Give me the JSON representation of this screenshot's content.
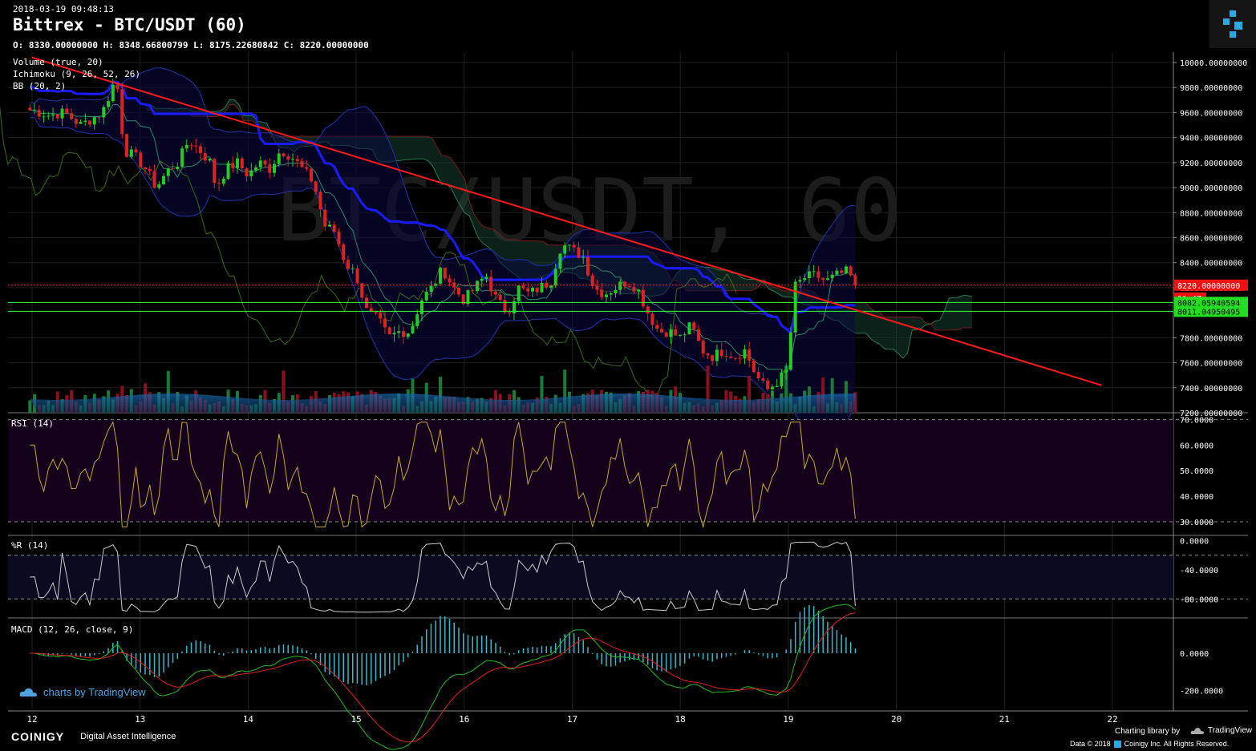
{
  "header": {
    "timestamp": "2018-03-19 09:48:13",
    "title": "Bittrex - BTC/USDT (60)",
    "ohlc": "O: 8330.00000000 H: 8348.66800799 L: 8175.22680842 C: 8220.00000000"
  },
  "watermark": "BTC/USDT, 60",
  "indicators": {
    "volume": "Volume (true, 20)",
    "ichimoku": "Ichimoku (9, 26, 52, 26)",
    "bb": "BB (20, 2)",
    "rsi": "RSI (14)",
    "willr": "%R (14)",
    "macd": "MACD (12, 26, close, 9)"
  },
  "price_badges": {
    "last_price": "8220.00000000",
    "countdown": "11:47",
    "level_1": "8082.05940594",
    "level_2": "8011.04950495"
  },
  "colors": {
    "up": "#22cc22",
    "down": "#dd2222",
    "trendline": "#ff1a1a",
    "bb_mid": "#1a1aff",
    "level": "#33ff33",
    "rsi": "#c8a830",
    "willr": "#cccccc",
    "macd": "#22bb22",
    "signal": "#dd2222",
    "hist": "#33bbcc"
  },
  "branding": {
    "tv_chart": "charts by TradingView",
    "coinigy": "COINIGY",
    "tagline": "Digital Asset Intelligence",
    "charting_by": "Charting library by",
    "tradingview": "TradingView",
    "copyright": "Data © 2018",
    "coinigy_rights": "Coinigy Inc. All Rights Reserved."
  },
  "chart_data": [
    {
      "type": "candlestick",
      "title": "Bittrex - BTC/USDT (60)",
      "x_ticks": [
        "12",
        "13",
        "14",
        "15",
        "16",
        "17",
        "18",
        "19",
        "20",
        "21",
        "22"
      ],
      "y_ticks": [
        "10000.00000000",
        "9800.00000000",
        "9600.00000000",
        "9400.00000000",
        "9200.00000000",
        "9000.00000000",
        "8800.00000000",
        "8600.00000000",
        "8400.00000000",
        "8200.00000000",
        "8000.00000000",
        "7800.00000000",
        "7600.00000000",
        "7400.00000000",
        "7200.00000000"
      ],
      "ylim": [
        7200,
        10100
      ],
      "last": 8220,
      "trendline": {
        "from": [
          11.8,
          10040
        ],
        "to": [
          21.7,
          7420
        ]
      },
      "close_path": [
        [
          11.8,
          9620
        ],
        [
          11.95,
          9580
        ],
        [
          12.1,
          9600
        ],
        [
          12.25,
          9500
        ],
        [
          12.35,
          9550
        ],
        [
          12.45,
          9600
        ],
        [
          12.55,
          9820
        ],
        [
          12.6,
          9780
        ],
        [
          12.65,
          9300
        ],
        [
          12.75,
          9250
        ],
        [
          12.85,
          9150
        ],
        [
          12.95,
          9000
        ],
        [
          13.05,
          9130
        ],
        [
          13.15,
          9200
        ],
        [
          13.25,
          9380
        ],
        [
          13.35,
          9300
        ],
        [
          13.45,
          9200
        ],
        [
          13.5,
          9000
        ],
        [
          13.6,
          9150
        ],
        [
          13.7,
          9200
        ],
        [
          13.8,
          9100
        ],
        [
          13.9,
          9200
        ],
        [
          14.0,
          9150
        ],
        [
          14.1,
          9300
        ],
        [
          14.2,
          9250
        ],
        [
          14.3,
          9150
        ],
        [
          14.4,
          9050
        ],
        [
          14.45,
          8900
        ],
        [
          14.5,
          8700
        ],
        [
          14.6,
          8650
        ],
        [
          14.7,
          8400
        ],
        [
          14.8,
          8300
        ],
        [
          14.9,
          8000
        ],
        [
          15.0,
          7950
        ],
        [
          15.1,
          7800
        ],
        [
          15.2,
          7850
        ],
        [
          15.3,
          7850
        ],
        [
          15.4,
          8100
        ],
        [
          15.5,
          8200
        ],
        [
          15.6,
          8350
        ],
        [
          15.7,
          8200
        ],
        [
          15.8,
          8100
        ],
        [
          15.9,
          8200
        ],
        [
          16.0,
          8300
        ],
        [
          16.1,
          8100
        ],
        [
          16.2,
          8000
        ],
        [
          16.3,
          8200
        ],
        [
          16.4,
          8150
        ],
        [
          16.5,
          8200
        ],
        [
          16.6,
          8250
        ],
        [
          16.7,
          8550
        ],
        [
          16.8,
          8500
        ],
        [
          16.9,
          8450
        ],
        [
          17.0,
          8200
        ],
        [
          17.1,
          8150
        ],
        [
          17.2,
          8200
        ],
        [
          17.3,
          8250
        ],
        [
          17.4,
          8200
        ],
        [
          17.5,
          8000
        ],
        [
          17.6,
          7850
        ],
        [
          17.7,
          7850
        ],
        [
          17.8,
          7800
        ],
        [
          17.9,
          7900
        ],
        [
          18.0,
          7700
        ],
        [
          18.1,
          7650
        ],
        [
          18.2,
          7700
        ],
        [
          18.3,
          7650
        ],
        [
          18.4,
          7700
        ],
        [
          18.5,
          7500
        ],
        [
          18.6,
          7380
        ],
        [
          18.7,
          7450
        ],
        [
          18.8,
          7550
        ],
        [
          18.85,
          8200
        ],
        [
          18.95,
          8280
        ],
        [
          19.05,
          8300
        ],
        [
          19.15,
          8250
        ],
        [
          19.25,
          8300
        ],
        [
          19.35,
          8330
        ],
        [
          19.42,
          8220
        ]
      ]
    },
    {
      "type": "line",
      "title": "RSI (14)",
      "y_ticks": [
        "70.0000",
        "60.0000",
        "50.0000",
        "40.0000",
        "30.0000"
      ],
      "ylim": [
        25,
        72
      ]
    },
    {
      "type": "line",
      "title": "%R (14)",
      "y_ticks": [
        "0.0000",
        "-40.0000",
        "-80.0000"
      ],
      "ylim": [
        -105,
        5
      ]
    },
    {
      "type": "line",
      "title": "MACD (12, 26, close, 9)",
      "y_ticks": [
        "0.0000",
        "-200.0000"
      ],
      "ylim": [
        -300,
        180
      ]
    }
  ]
}
